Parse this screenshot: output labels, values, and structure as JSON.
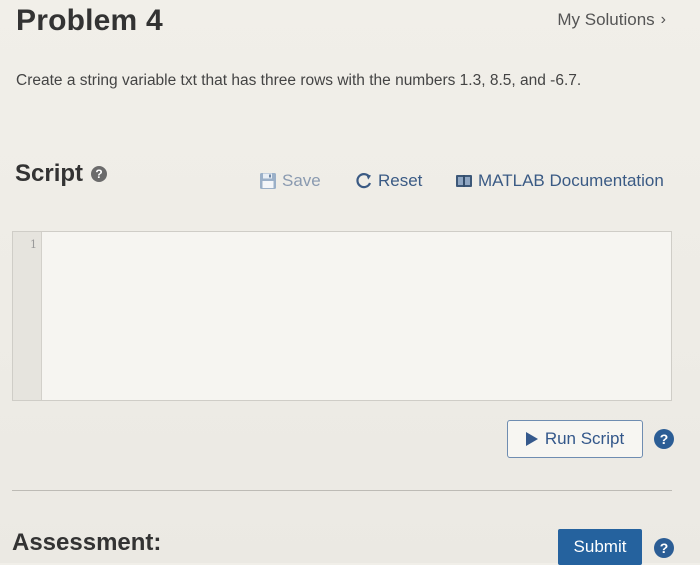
{
  "header": {
    "title": "Problem 4",
    "my_solutions_label": "My Solutions",
    "my_solutions_chevron": "›"
  },
  "problem": {
    "description": "Create a string variable txt that has three rows with the numbers 1.3, 8.5, and -6.7."
  },
  "script": {
    "heading": "Script",
    "help_icon": "question-circle-icon",
    "toolbar": {
      "save_label": "Save",
      "reset_label": "Reset",
      "documentation_label": "MATLAB Documentation"
    },
    "editor": {
      "line_numbers": [
        "1"
      ],
      "code": ""
    }
  },
  "actions": {
    "run_label": "Run Script",
    "submit_label": "Submit"
  },
  "assessment": {
    "heading": "Assessment:"
  },
  "colors": {
    "accent_blue": "#25629e",
    "link_blue": "#3a5a84",
    "disabled_gray": "#8a9ab0",
    "background": "#efede7"
  }
}
